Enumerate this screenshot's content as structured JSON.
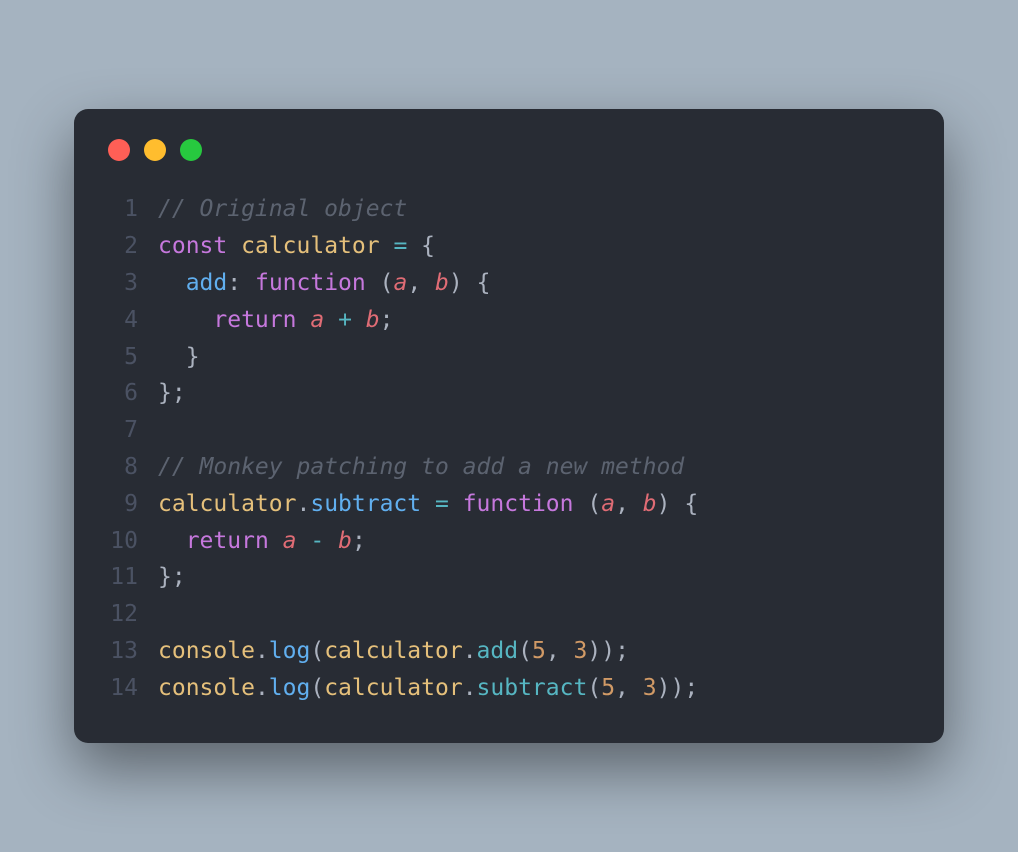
{
  "window": {
    "traffic_lights": [
      "close",
      "minimize",
      "maximize"
    ]
  },
  "code": {
    "lines": [
      {
        "num": "1",
        "tokens": [
          {
            "cls": "c-comment",
            "text": "// Original object"
          }
        ]
      },
      {
        "num": "2",
        "tokens": [
          {
            "cls": "c-keyword",
            "text": "const"
          },
          {
            "cls": "c-default",
            "text": " "
          },
          {
            "cls": "c-var",
            "text": "calculator"
          },
          {
            "cls": "c-default",
            "text": " "
          },
          {
            "cls": "c-op",
            "text": "="
          },
          {
            "cls": "c-default",
            "text": " "
          },
          {
            "cls": "c-punct",
            "text": "{"
          }
        ]
      },
      {
        "num": "3",
        "tokens": [
          {
            "cls": "c-default",
            "text": "  "
          },
          {
            "cls": "c-func",
            "text": "add"
          },
          {
            "cls": "c-punct",
            "text": ":"
          },
          {
            "cls": "c-default",
            "text": " "
          },
          {
            "cls": "c-keyword",
            "text": "function"
          },
          {
            "cls": "c-default",
            "text": " "
          },
          {
            "cls": "c-punct",
            "text": "("
          },
          {
            "cls": "c-param",
            "text": "a"
          },
          {
            "cls": "c-punct",
            "text": ","
          },
          {
            "cls": "c-default",
            "text": " "
          },
          {
            "cls": "c-param",
            "text": "b"
          },
          {
            "cls": "c-punct",
            "text": ")"
          },
          {
            "cls": "c-default",
            "text": " "
          },
          {
            "cls": "c-punct",
            "text": "{"
          }
        ]
      },
      {
        "num": "4",
        "tokens": [
          {
            "cls": "c-default",
            "text": "    "
          },
          {
            "cls": "c-keyword",
            "text": "return"
          },
          {
            "cls": "c-default",
            "text": " "
          },
          {
            "cls": "c-param",
            "text": "a"
          },
          {
            "cls": "c-default",
            "text": " "
          },
          {
            "cls": "c-op",
            "text": "+"
          },
          {
            "cls": "c-default",
            "text": " "
          },
          {
            "cls": "c-param",
            "text": "b"
          },
          {
            "cls": "c-punct",
            "text": ";"
          }
        ]
      },
      {
        "num": "5",
        "tokens": [
          {
            "cls": "c-default",
            "text": "  "
          },
          {
            "cls": "c-punct",
            "text": "}"
          }
        ]
      },
      {
        "num": "6",
        "tokens": [
          {
            "cls": "c-punct",
            "text": "};"
          }
        ]
      },
      {
        "num": "7",
        "tokens": [
          {
            "cls": "c-default",
            "text": ""
          }
        ]
      },
      {
        "num": "8",
        "tokens": [
          {
            "cls": "c-comment",
            "text": "// Monkey patching to add a new method"
          }
        ]
      },
      {
        "num": "9",
        "tokens": [
          {
            "cls": "c-var",
            "text": "calculator"
          },
          {
            "cls": "c-punct",
            "text": "."
          },
          {
            "cls": "c-func",
            "text": "subtract"
          },
          {
            "cls": "c-default",
            "text": " "
          },
          {
            "cls": "c-op",
            "text": "="
          },
          {
            "cls": "c-default",
            "text": " "
          },
          {
            "cls": "c-keyword",
            "text": "function"
          },
          {
            "cls": "c-default",
            "text": " "
          },
          {
            "cls": "c-punct",
            "text": "("
          },
          {
            "cls": "c-param",
            "text": "a"
          },
          {
            "cls": "c-punct",
            "text": ","
          },
          {
            "cls": "c-default",
            "text": " "
          },
          {
            "cls": "c-param",
            "text": "b"
          },
          {
            "cls": "c-punct",
            "text": ")"
          },
          {
            "cls": "c-default",
            "text": " "
          },
          {
            "cls": "c-punct",
            "text": "{"
          }
        ]
      },
      {
        "num": "10",
        "tokens": [
          {
            "cls": "c-default",
            "text": "  "
          },
          {
            "cls": "c-keyword",
            "text": "return"
          },
          {
            "cls": "c-default",
            "text": " "
          },
          {
            "cls": "c-param",
            "text": "a"
          },
          {
            "cls": "c-default",
            "text": " "
          },
          {
            "cls": "c-op",
            "text": "-"
          },
          {
            "cls": "c-default",
            "text": " "
          },
          {
            "cls": "c-param",
            "text": "b"
          },
          {
            "cls": "c-punct",
            "text": ";"
          }
        ]
      },
      {
        "num": "11",
        "tokens": [
          {
            "cls": "c-punct",
            "text": "};"
          }
        ]
      },
      {
        "num": "12",
        "tokens": [
          {
            "cls": "c-default",
            "text": ""
          }
        ]
      },
      {
        "num": "13",
        "tokens": [
          {
            "cls": "c-var",
            "text": "console"
          },
          {
            "cls": "c-punct",
            "text": "."
          },
          {
            "cls": "c-func",
            "text": "log"
          },
          {
            "cls": "c-punct",
            "text": "("
          },
          {
            "cls": "c-var",
            "text": "calculator"
          },
          {
            "cls": "c-punct",
            "text": "."
          },
          {
            "cls": "c-method",
            "text": "add"
          },
          {
            "cls": "c-punct",
            "text": "("
          },
          {
            "cls": "c-number",
            "text": "5"
          },
          {
            "cls": "c-punct",
            "text": ","
          },
          {
            "cls": "c-default",
            "text": " "
          },
          {
            "cls": "c-number",
            "text": "3"
          },
          {
            "cls": "c-punct",
            "text": "));"
          }
        ]
      },
      {
        "num": "14",
        "tokens": [
          {
            "cls": "c-var",
            "text": "console"
          },
          {
            "cls": "c-punct",
            "text": "."
          },
          {
            "cls": "c-func",
            "text": "log"
          },
          {
            "cls": "c-punct",
            "text": "("
          },
          {
            "cls": "c-var",
            "text": "calculator"
          },
          {
            "cls": "c-punct",
            "text": "."
          },
          {
            "cls": "c-method",
            "text": "subtract"
          },
          {
            "cls": "c-punct",
            "text": "("
          },
          {
            "cls": "c-number",
            "text": "5"
          },
          {
            "cls": "c-punct",
            "text": ","
          },
          {
            "cls": "c-default",
            "text": " "
          },
          {
            "cls": "c-number",
            "text": "3"
          },
          {
            "cls": "c-punct",
            "text": "));"
          }
        ]
      }
    ]
  }
}
